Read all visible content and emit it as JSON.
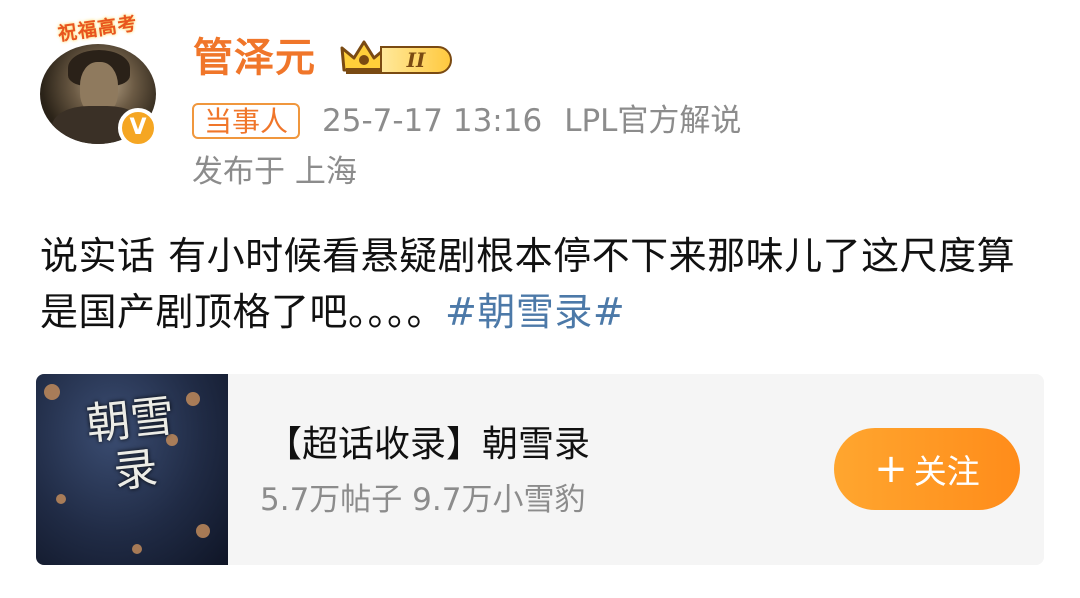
{
  "author": {
    "avatar_frame_text": "祝福高考",
    "verified_mark": "V",
    "name": "管泽元",
    "level_badge": "II",
    "tag": "当事人",
    "timestamp": "25-7-17 13:16",
    "source": "LPL官方解说",
    "location": "发布于 上海"
  },
  "post": {
    "text": "说实话 有小时候看悬疑剧根本停不下来那味儿了这尺度算是国产剧顶格了吧。。。。",
    "hashtag": "#朝雪录#"
  },
  "supertopic_card": {
    "thumbnail_title": "朝雪录",
    "title": "【超话收录】朝雪录",
    "stats": "5.7万帖子 9.7万小雪豹",
    "follow_label": "关注",
    "follow_icon": "plus-icon"
  },
  "colors": {
    "username": "#f0762a",
    "meta_gray": "#8c8c8c",
    "hashtag": "#4c79a8",
    "follow_button": "#ff9a24",
    "card_bg": "#f5f5f5"
  }
}
